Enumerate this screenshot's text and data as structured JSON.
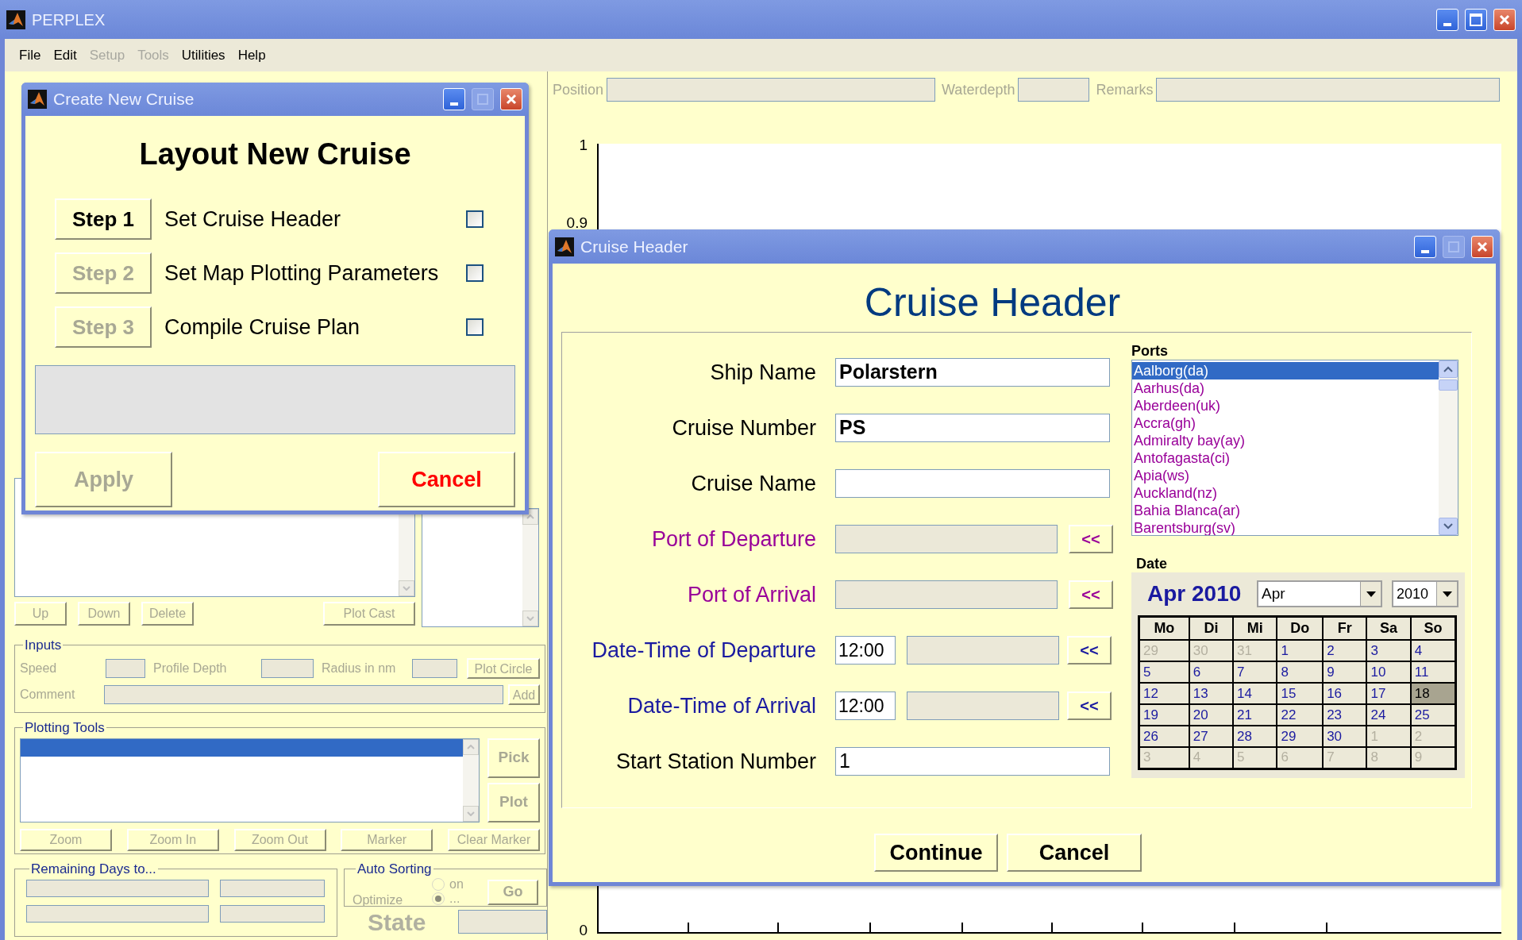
{
  "main_window": {
    "title": "PERPLEX",
    "menu": [
      {
        "label": "File",
        "disabled": false
      },
      {
        "label": "Edit",
        "disabled": false
      },
      {
        "label": "Setup",
        "disabled": true
      },
      {
        "label": "Tools",
        "disabled": true
      },
      {
        "label": "Utilities",
        "disabled": false
      },
      {
        "label": "Help",
        "disabled": false
      }
    ],
    "header_fields": [
      {
        "label": "Position"
      },
      {
        "label": "Waterdepth"
      },
      {
        "label": "Remarks"
      }
    ],
    "plot": {
      "y_tick_labels": [
        "1",
        "0.9",
        "0"
      ]
    },
    "cast_buttons": [
      {
        "label": "Up",
        "disabled": true
      },
      {
        "label": "Down",
        "disabled": true
      },
      {
        "label": "Delete",
        "disabled": true
      },
      {
        "label": "Plot Cast",
        "disabled": true
      }
    ],
    "inputs": {
      "title": "Inputs",
      "fields": [
        {
          "label": "Speed"
        },
        {
          "label": "Profile Depth"
        },
        {
          "label": "Radius in nm"
        }
      ],
      "plot_circle": {
        "label": "Plot Circle",
        "disabled": true
      },
      "comment_label": "Comment",
      "add": {
        "label": "Add",
        "disabled": true
      }
    },
    "plotting_tools": {
      "title": "Plotting Tools",
      "side_buttons": [
        {
          "label": "Pick",
          "disabled": true
        },
        {
          "label": "Plot",
          "disabled": true
        }
      ],
      "buttons": [
        {
          "label": "Zoom",
          "disabled": true
        },
        {
          "label": "Zoom In",
          "disabled": true
        },
        {
          "label": "Zoom Out",
          "disabled": true
        },
        {
          "label": "Marker",
          "disabled": true
        },
        {
          "label": "Clear Marker",
          "disabled": true
        }
      ]
    },
    "remaining_days": {
      "title": "Remaining Days to..."
    },
    "auto_sorting": {
      "title": "Auto Sorting",
      "label": "Optimize",
      "options": [
        {
          "label": "on",
          "selected": false
        },
        {
          "label": "...",
          "selected": true
        }
      ],
      "go": {
        "label": "Go",
        "disabled": true
      }
    },
    "state_label": "State"
  },
  "create_new_cruise": {
    "title": "Create New Cruise",
    "heading": "Layout New Cruise",
    "steps": [
      {
        "button": "Step 1",
        "label": "Set Cruise Header",
        "disabled": false,
        "checked": false
      },
      {
        "button": "Step 2",
        "label": "Set Map Plotting Parameters",
        "disabled": true,
        "checked": false
      },
      {
        "button": "Step 3",
        "label": "Compile Cruise Plan",
        "disabled": true,
        "checked": false
      }
    ],
    "apply": {
      "label": "Apply",
      "disabled": true
    },
    "cancel": {
      "label": "Cancel",
      "disabled": false
    }
  },
  "cruise_header": {
    "title": "Cruise Header",
    "heading": "Cruise Header",
    "fields": [
      {
        "kind": "text",
        "label": "Ship Name",
        "color": "#000000",
        "value": "Polarstern",
        "bold": true
      },
      {
        "kind": "text",
        "label": "Cruise Number",
        "color": "#000000",
        "value": "PS",
        "bold": true
      },
      {
        "kind": "text",
        "label": "Cruise Name",
        "color": "#000000"
      },
      {
        "kind": "port",
        "label": "Port of Departure",
        "color": "#990099",
        "button": "<<"
      },
      {
        "kind": "port",
        "label": "Port of Arrival",
        "color": "#990099",
        "button": "<<"
      },
      {
        "kind": "datetime",
        "label": "Date-Time of Departure",
        "color": "#1a1aa0",
        "time": "12:00",
        "button": "<<"
      },
      {
        "kind": "datetime",
        "label": "Date-Time of Arrival",
        "color": "#1a1aa0",
        "time": "12:00",
        "button": "<<"
      },
      {
        "kind": "text",
        "label": "Start Station Number",
        "color": "#000000",
        "value": "1",
        "bold": false
      }
    ],
    "ports": {
      "title": "Ports",
      "items": [
        {
          "label": "Aalborg(da)",
          "selected": true
        },
        {
          "label": "Aarhus(da)",
          "selected": false
        },
        {
          "label": "Aberdeen(uk)",
          "selected": false
        },
        {
          "label": "Accra(gh)",
          "selected": false
        },
        {
          "label": "Admiralty bay(ay)",
          "selected": false
        },
        {
          "label": "Antofagasta(ci)",
          "selected": false
        },
        {
          "label": "Apia(ws)",
          "selected": false
        },
        {
          "label": "Auckland(nz)",
          "selected": false
        },
        {
          "label": "Bahia Blanca(ar)",
          "selected": false
        },
        {
          "label": "Barentsburg(sv)",
          "selected": false
        }
      ]
    },
    "date": {
      "title": "Date",
      "month_label": "Apr 2010",
      "month_select": "Apr",
      "year_select": "2010",
      "weekdays": [
        "Mo",
        "Di",
        "Mi",
        "Do",
        "Fr",
        "Sa",
        "So"
      ],
      "weeks": [
        [
          {
            "day": "29",
            "in_month": false,
            "selected": false
          },
          {
            "day": "30",
            "in_month": false,
            "selected": false
          },
          {
            "day": "31",
            "in_month": false,
            "selected": false
          },
          {
            "day": "1",
            "in_month": true,
            "selected": false
          },
          {
            "day": "2",
            "in_month": true,
            "selected": false
          },
          {
            "day": "3",
            "in_month": true,
            "selected": false
          },
          {
            "day": "4",
            "in_month": true,
            "selected": false
          }
        ],
        [
          {
            "day": "5",
            "in_month": true,
            "selected": false
          },
          {
            "day": "6",
            "in_month": true,
            "selected": false
          },
          {
            "day": "7",
            "in_month": true,
            "selected": false
          },
          {
            "day": "8",
            "in_month": true,
            "selected": false
          },
          {
            "day": "9",
            "in_month": true,
            "selected": false
          },
          {
            "day": "10",
            "in_month": true,
            "selected": false
          },
          {
            "day": "11",
            "in_month": true,
            "selected": false
          }
        ],
        [
          {
            "day": "12",
            "in_month": true,
            "selected": false
          },
          {
            "day": "13",
            "in_month": true,
            "selected": false
          },
          {
            "day": "14",
            "in_month": true,
            "selected": false
          },
          {
            "day": "15",
            "in_month": true,
            "selected": false
          },
          {
            "day": "16",
            "in_month": true,
            "selected": false
          },
          {
            "day": "17",
            "in_month": true,
            "selected": false
          },
          {
            "day": "18",
            "in_month": true,
            "selected": true
          }
        ],
        [
          {
            "day": "19",
            "in_month": true,
            "selected": false
          },
          {
            "day": "20",
            "in_month": true,
            "selected": false
          },
          {
            "day": "21",
            "in_month": true,
            "selected": false
          },
          {
            "day": "22",
            "in_month": true,
            "selected": false
          },
          {
            "day": "23",
            "in_month": true,
            "selected": false
          },
          {
            "day": "24",
            "in_month": true,
            "selected": false
          },
          {
            "day": "25",
            "in_month": true,
            "selected": false
          }
        ],
        [
          {
            "day": "26",
            "in_month": true,
            "selected": false
          },
          {
            "day": "27",
            "in_month": true,
            "selected": false
          },
          {
            "day": "28",
            "in_month": true,
            "selected": false
          },
          {
            "day": "29",
            "in_month": true,
            "selected": false
          },
          {
            "day": "30",
            "in_month": true,
            "selected": false
          },
          {
            "day": "1",
            "in_month": false,
            "selected": false
          },
          {
            "day": "2",
            "in_month": false,
            "selected": false
          }
        ],
        [
          {
            "day": "3",
            "in_month": false,
            "selected": false
          },
          {
            "day": "4",
            "in_month": false,
            "selected": false
          },
          {
            "day": "5",
            "in_month": false,
            "selected": false
          },
          {
            "day": "6",
            "in_month": false,
            "selected": false
          },
          {
            "day": "7",
            "in_month": false,
            "selected": false
          },
          {
            "day": "8",
            "in_month": false,
            "selected": false
          },
          {
            "day": "9",
            "in_month": false,
            "selected": false
          }
        ]
      ]
    },
    "continue": {
      "label": "Continue"
    },
    "cancel": {
      "label": "Cancel"
    }
  }
}
